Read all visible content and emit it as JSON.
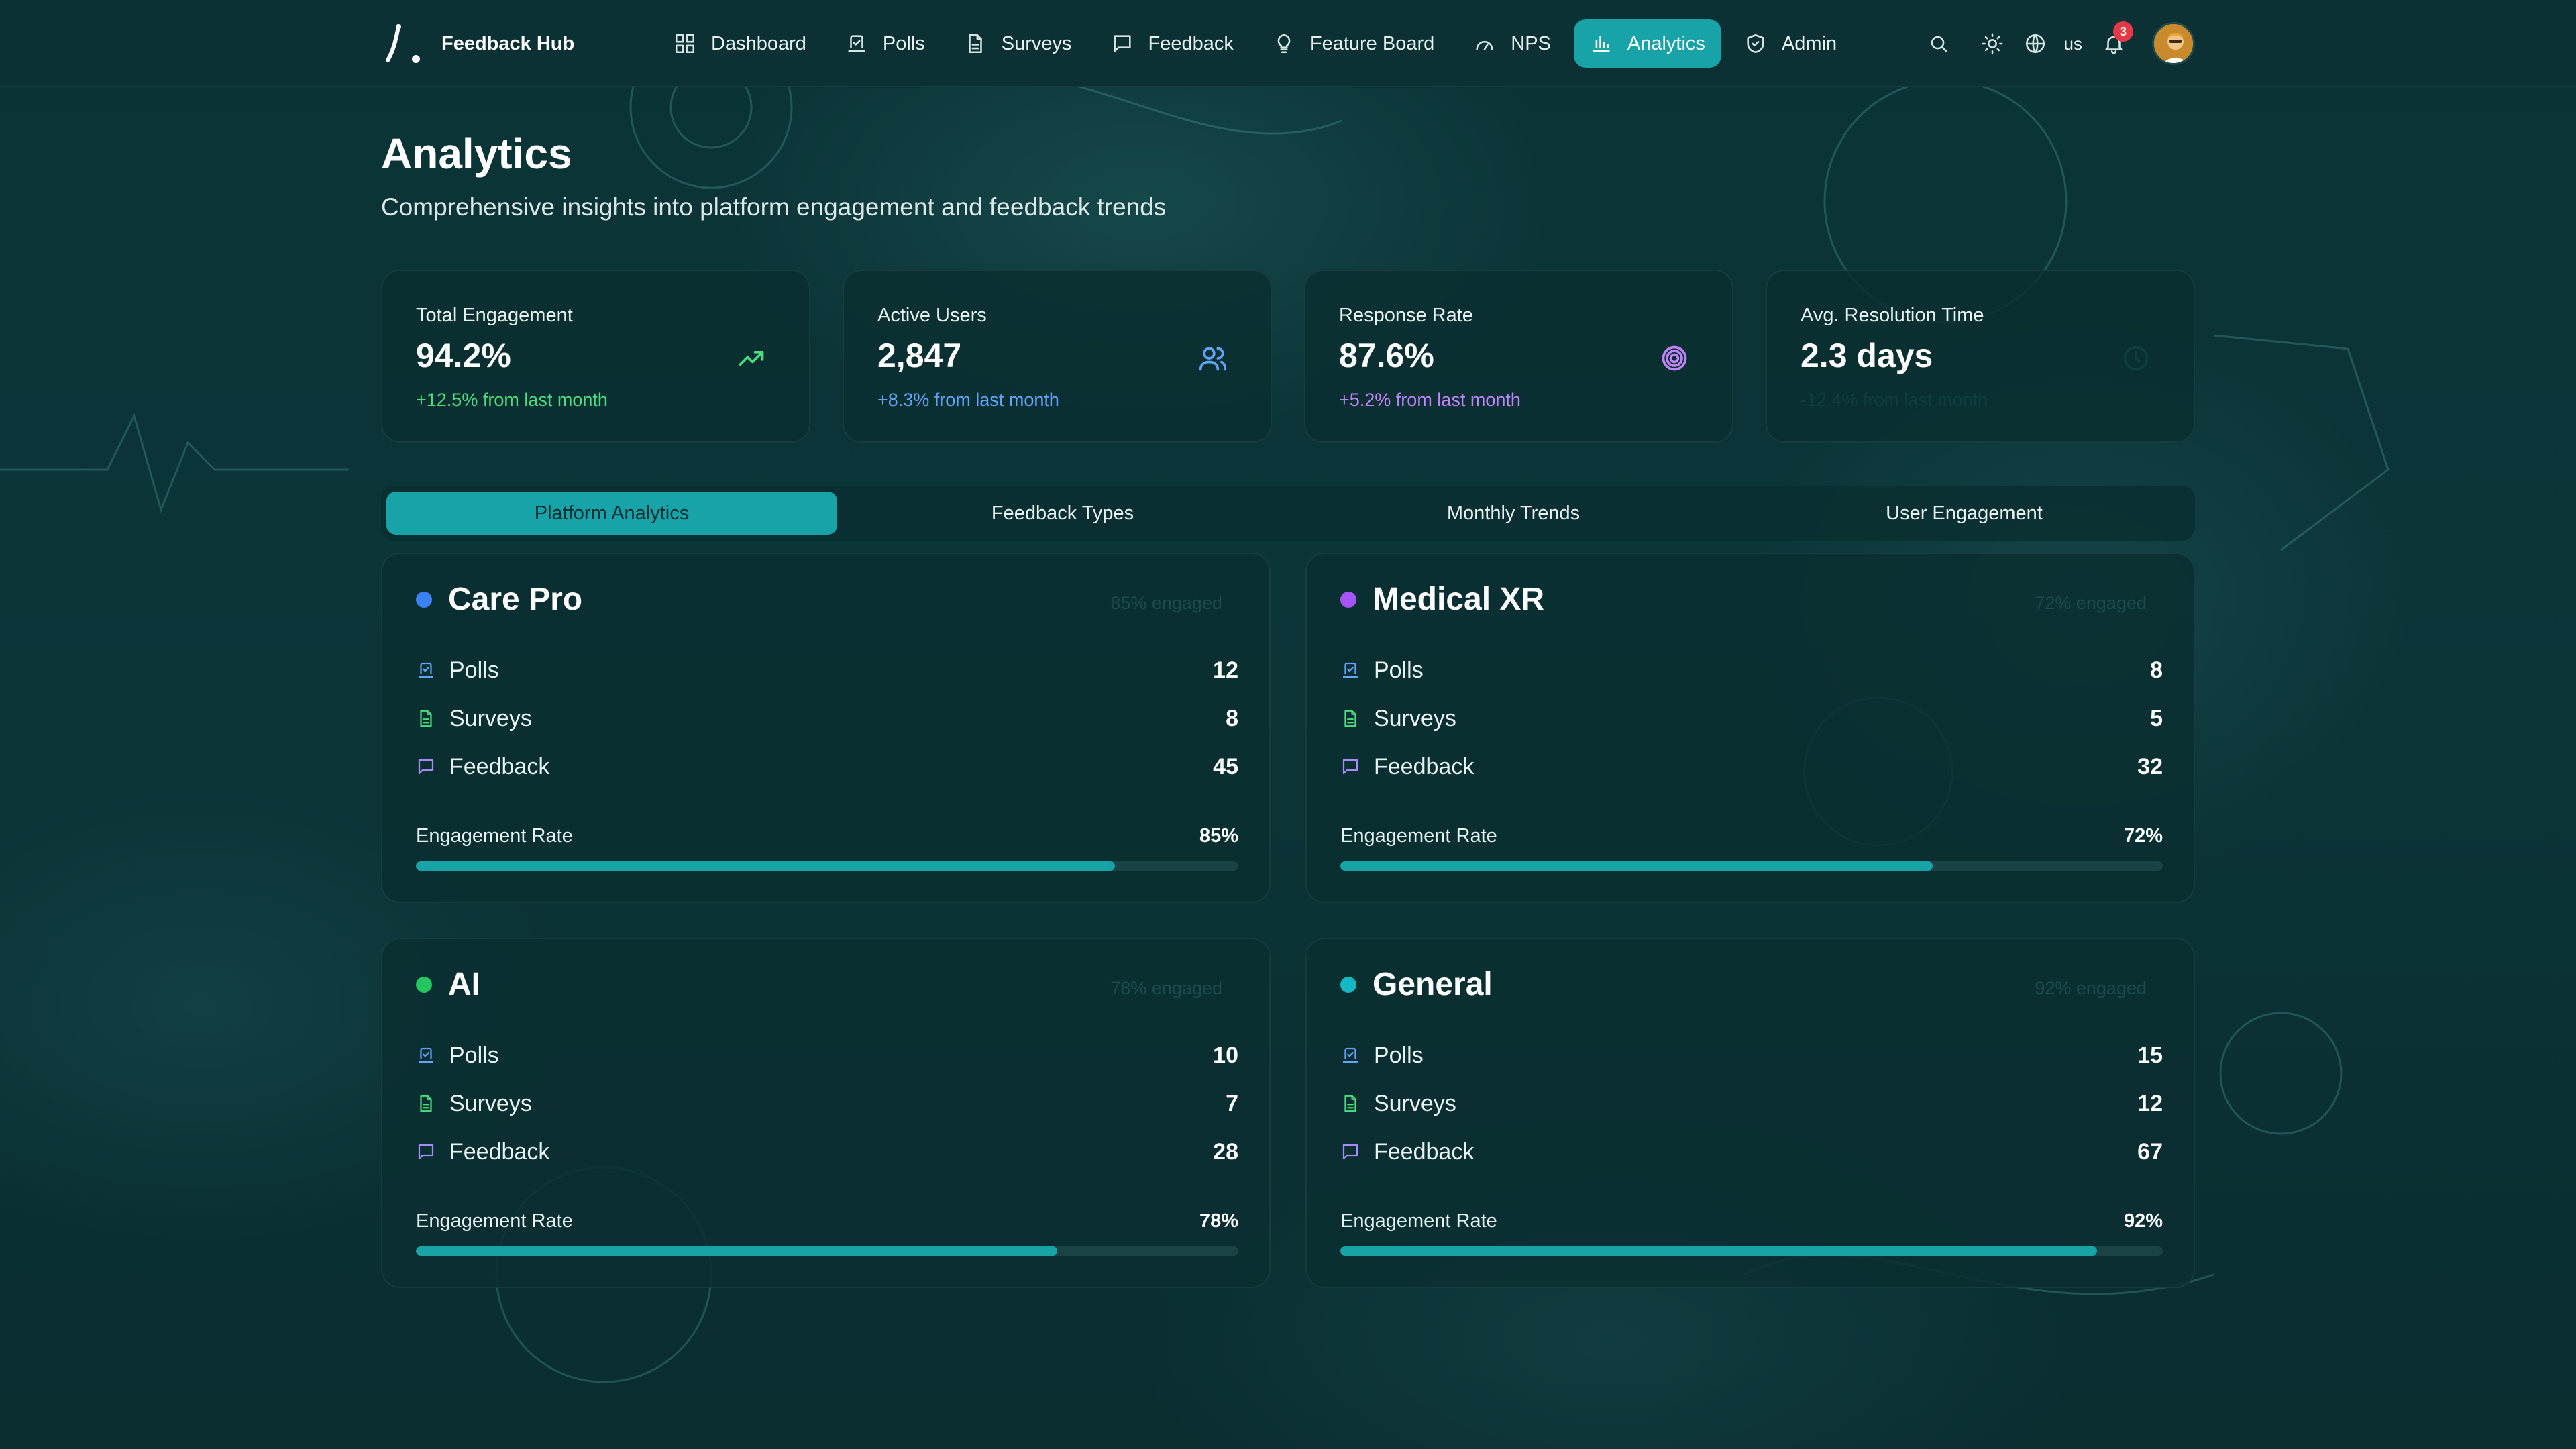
{
  "app": {
    "name": "Feedback Hub"
  },
  "nav": {
    "items": [
      {
        "label": "Dashboard",
        "icon": "dashboard-icon",
        "active": false
      },
      {
        "label": "Polls",
        "icon": "poll-icon",
        "active": false
      },
      {
        "label": "Surveys",
        "icon": "document-icon",
        "active": false
      },
      {
        "label": "Feedback",
        "icon": "message-icon",
        "active": false
      },
      {
        "label": "Feature Board",
        "icon": "lightbulb-icon",
        "active": false
      },
      {
        "label": "NPS",
        "icon": "gauge-icon",
        "active": false
      },
      {
        "label": "Analytics",
        "icon": "bar-chart-icon",
        "active": true
      },
      {
        "label": "Admin",
        "icon": "shield-icon",
        "active": false
      }
    ],
    "language": "us",
    "notification_count": "3"
  },
  "page": {
    "title": "Analytics",
    "subtitle": "Comprehensive insights into platform engagement and feedback trends"
  },
  "stats": [
    {
      "label": "Total Engagement",
      "value": "94.2%",
      "change": "+12.5% from last month",
      "color": "#4ade80",
      "icon": "trending-up-icon"
    },
    {
      "label": "Active Users",
      "value": "2,847",
      "change": "+8.3% from last month",
      "color": "#60a5fa",
      "icon": "users-icon"
    },
    {
      "label": "Response Rate",
      "value": "87.6%",
      "change": "+5.2% from last month",
      "color": "#c084fc",
      "icon": "target-icon"
    },
    {
      "label": "Avg. Resolution Time",
      "value": "2.3 days",
      "change": "-12.4% from last month",
      "color": "#0f3e41",
      "icon": "clock-icon"
    }
  ],
  "tabs": [
    {
      "label": "Platform Analytics",
      "active": true
    },
    {
      "label": "Feedback Types",
      "active": false
    },
    {
      "label": "Monthly Trends",
      "active": false
    },
    {
      "label": "User Engagement",
      "active": false
    }
  ],
  "platforms": [
    {
      "name": "Care Pro",
      "dot_color": "#3b82f6",
      "engaged": "85% engaged",
      "polls": "12",
      "surveys": "8",
      "feedback": "45",
      "engagement_rate": 85,
      "engagement_label": "85%"
    },
    {
      "name": "Medical XR",
      "dot_color": "#a855f7",
      "engaged": "72% engaged",
      "polls": "8",
      "surveys": "5",
      "feedback": "32",
      "engagement_rate": 72,
      "engagement_label": "72%"
    },
    {
      "name": "AI",
      "dot_color": "#22c55e",
      "engaged": "78% engaged",
      "polls": "10",
      "surveys": "7",
      "feedback": "28",
      "engagement_rate": 78,
      "engagement_label": "78%"
    },
    {
      "name": "General",
      "dot_color": "#14b8c4",
      "engaged": "92% engaged",
      "polls": "15",
      "surveys": "12",
      "feedback": "67",
      "engagement_rate": 92,
      "engagement_label": "92%"
    }
  ],
  "labels": {
    "polls": "Polls",
    "surveys": "Surveys",
    "feedback": "Feedback",
    "engagement_rate": "Engagement Rate"
  },
  "colors": {
    "accent": "#17a3a8",
    "polls_icon": "#60a5fa",
    "surveys_icon": "#4ade80",
    "feedback_icon": "#a78bfa"
  }
}
